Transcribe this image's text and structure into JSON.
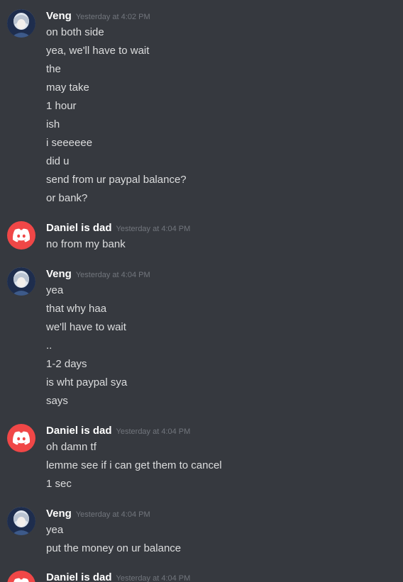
{
  "groups": [
    {
      "avatar": "anime-avatar-icon",
      "username": "Veng",
      "timestamp": "Yesterday at 4:02 PM",
      "lines": [
        "on both side",
        "yea, we'll have to wait",
        "the",
        "may take",
        "1 hour",
        "ish",
        "i seeeeee",
        "did u",
        "send from ur paypal balance?",
        "or bank?"
      ]
    },
    {
      "avatar": "discord-logo-icon",
      "username": "Daniel is dad",
      "timestamp": "Yesterday at 4:04 PM",
      "lines": [
        "no from my bank"
      ]
    },
    {
      "avatar": "anime-avatar-icon",
      "username": "Veng",
      "timestamp": "Yesterday at 4:04 PM",
      "lines": [
        "yea",
        "that why haa",
        "we'll have to wait",
        "..",
        "1-2 days",
        "is wht paypal sya",
        "says"
      ]
    },
    {
      "avatar": "discord-logo-icon",
      "username": "Daniel is dad",
      "timestamp": "Yesterday at 4:04 PM",
      "lines": [
        "oh damn tf",
        "lemme see if i can get them to cancel",
        "1 sec"
      ]
    },
    {
      "avatar": "anime-avatar-icon",
      "username": "Veng",
      "timestamp": "Yesterday at 4:04 PM",
      "lines": [
        "yea",
        "put the money on ur balance"
      ]
    },
    {
      "avatar": "discord-logo-icon",
      "username": "Daniel is dad",
      "timestamp": "Yesterday at 4:04 PM",
      "lines": []
    }
  ],
  "colors": {
    "background": "#36393f",
    "username": "#ffffff",
    "timestamp": "#72767d",
    "message_text": "#dcddde",
    "discord_avatar": "#f04747"
  }
}
